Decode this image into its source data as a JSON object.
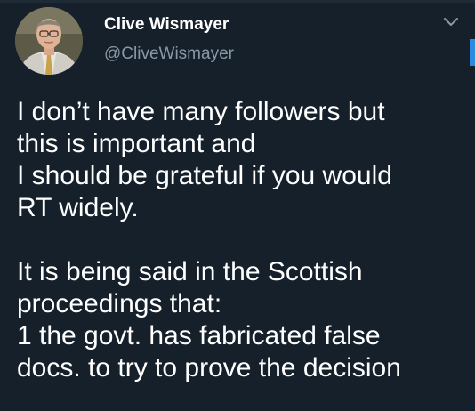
{
  "author": {
    "display_name": "Clive Wismayer",
    "handle": "@CliveWismayer"
  },
  "icons": {
    "menu": "chevron-down-icon",
    "avatar": "profile-photo"
  },
  "colors": {
    "background": "#15202b",
    "text": "#ffffff",
    "secondary_text": "#8899a6",
    "accent": "#1da1f2"
  },
  "tweet": {
    "paragraph_1": [
      "I don’t have many followers but",
      "this is important and",
      "I should be grateful if you would",
      "RT widely."
    ],
    "paragraph_2": [
      "It is being said in the Scottish",
      "proceedings that:",
      "1 the govt. has fabricated false",
      "docs. to try to prove the decision"
    ]
  }
}
